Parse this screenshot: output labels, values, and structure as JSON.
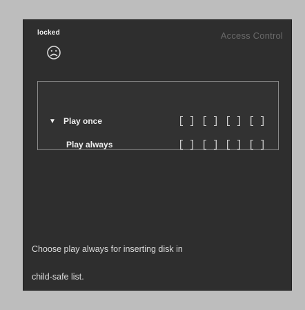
{
  "status": {
    "label": "locked",
    "icon": "sad-face-icon"
  },
  "screen": {
    "title": "Access Control"
  },
  "options": [
    {
      "bullet": "▼",
      "label": "Play once",
      "slots": [
        "[ ]",
        "[ ]",
        "[ ]",
        "[ ]"
      ],
      "selected": true
    },
    {
      "bullet": "",
      "label": "Play always",
      "slots": [
        "[ ]",
        "[ ]",
        "[ ]",
        "[ ]"
      ],
      "selected": false
    }
  ],
  "help": {
    "line1": "Choose play always for inserting disk in",
    "line2": "child-safe list."
  },
  "colors": {
    "background": "#2e2e2e",
    "frame": "#bdbdbd",
    "text": "#f0f0f0",
    "title": "#6a6a6a",
    "panel_border": "#8a8a8a"
  }
}
